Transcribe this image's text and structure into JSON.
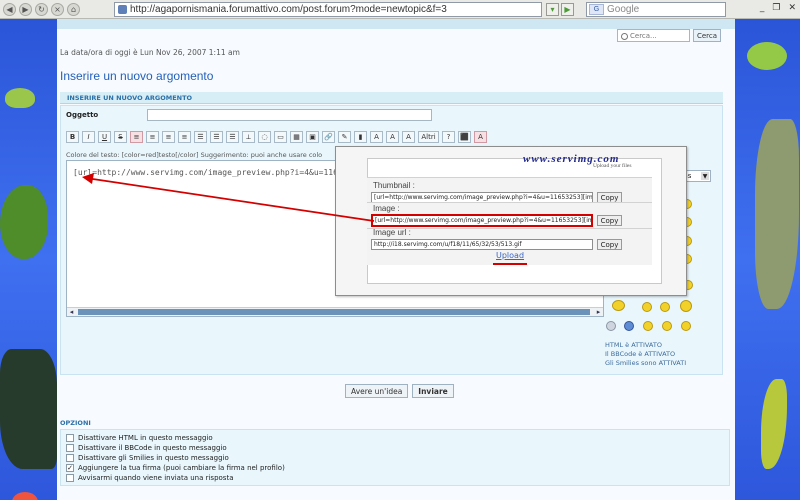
{
  "browser": {
    "url": "http://agapornismania.forumattivo.com/post.forum?mode=newtopic&f=3",
    "search_placeholder": "Google",
    "window_controls": [
      "_",
      "❐",
      "✕"
    ]
  },
  "forum": {
    "search_placeholder": "Cerca...",
    "search_button": "Cerca",
    "date_line": "La data/ora di oggi è Lun Nov 26, 2007 1:11 am",
    "page_title": "Inserire un nuovo argomento",
    "panel_header": "INSERIRE UN NUOVO ARGOMENTO",
    "subject_label": "Oggetto",
    "help_line": "Colore del testo: [color=red]testo[/color] Suggerimento: puoi anche usare colo",
    "editor_text": "[url=http://www.servimg.com/image_preview.php?i=4&u=11653",
    "font_select": "ons",
    "info_lines": [
      "HTML è ATTIVATO",
      "Il BBCode è ATTIVATO",
      "Gli Smilies sono ATTIVATI"
    ],
    "preview_button": "Avere un'idea",
    "submit_button": "Inviare",
    "options_header": "OPZIONI",
    "options": [
      {
        "label": "Disattivare HTML in questo messaggio",
        "checked": false
      },
      {
        "label": "Disattivare il BBCode in questo messaggio",
        "checked": false
      },
      {
        "label": "Disattivare gli Smilies in questo messaggio",
        "checked": false
      },
      {
        "label": "Aggiungere la tua firma (puoi cambiare la firma nel profilo)",
        "checked": true
      },
      {
        "label": "Avvisarmi quando viene inviata una risposta",
        "checked": false
      }
    ]
  },
  "toolbar": [
    "B",
    "I",
    "U",
    "S",
    "≡",
    "≡",
    "≡",
    "≡",
    "☰",
    "☰",
    "☰",
    "⟂",
    "◌",
    "▭",
    "▦",
    "▣",
    "🔗",
    "✎",
    "▮",
    "A",
    "A",
    "A",
    "Altri",
    "?",
    "⬛",
    "A"
  ],
  "servimg": {
    "logo": "www.servimg.com",
    "tagline": "Upload your files",
    "thumbnail_label": "Thumbnail :",
    "thumbnail_value": "[url=http://www.servimg.com/image_preview.php?i=4&u=11653253][img",
    "image_label": "Image :",
    "image_value": "[url=http://www.servimg.com/image_preview.php?i=4&u=11653253][img",
    "image_url_label": "Image url :",
    "image_url_value": "http://i18.servimg.com/u/f18/11/65/32/53/513.gif",
    "copy_label": "Copy",
    "upload_label": "Upload"
  },
  "colors": {
    "accent": "#245fb8",
    "highlight": "#d40000",
    "background_blue": "#3f70f0"
  }
}
